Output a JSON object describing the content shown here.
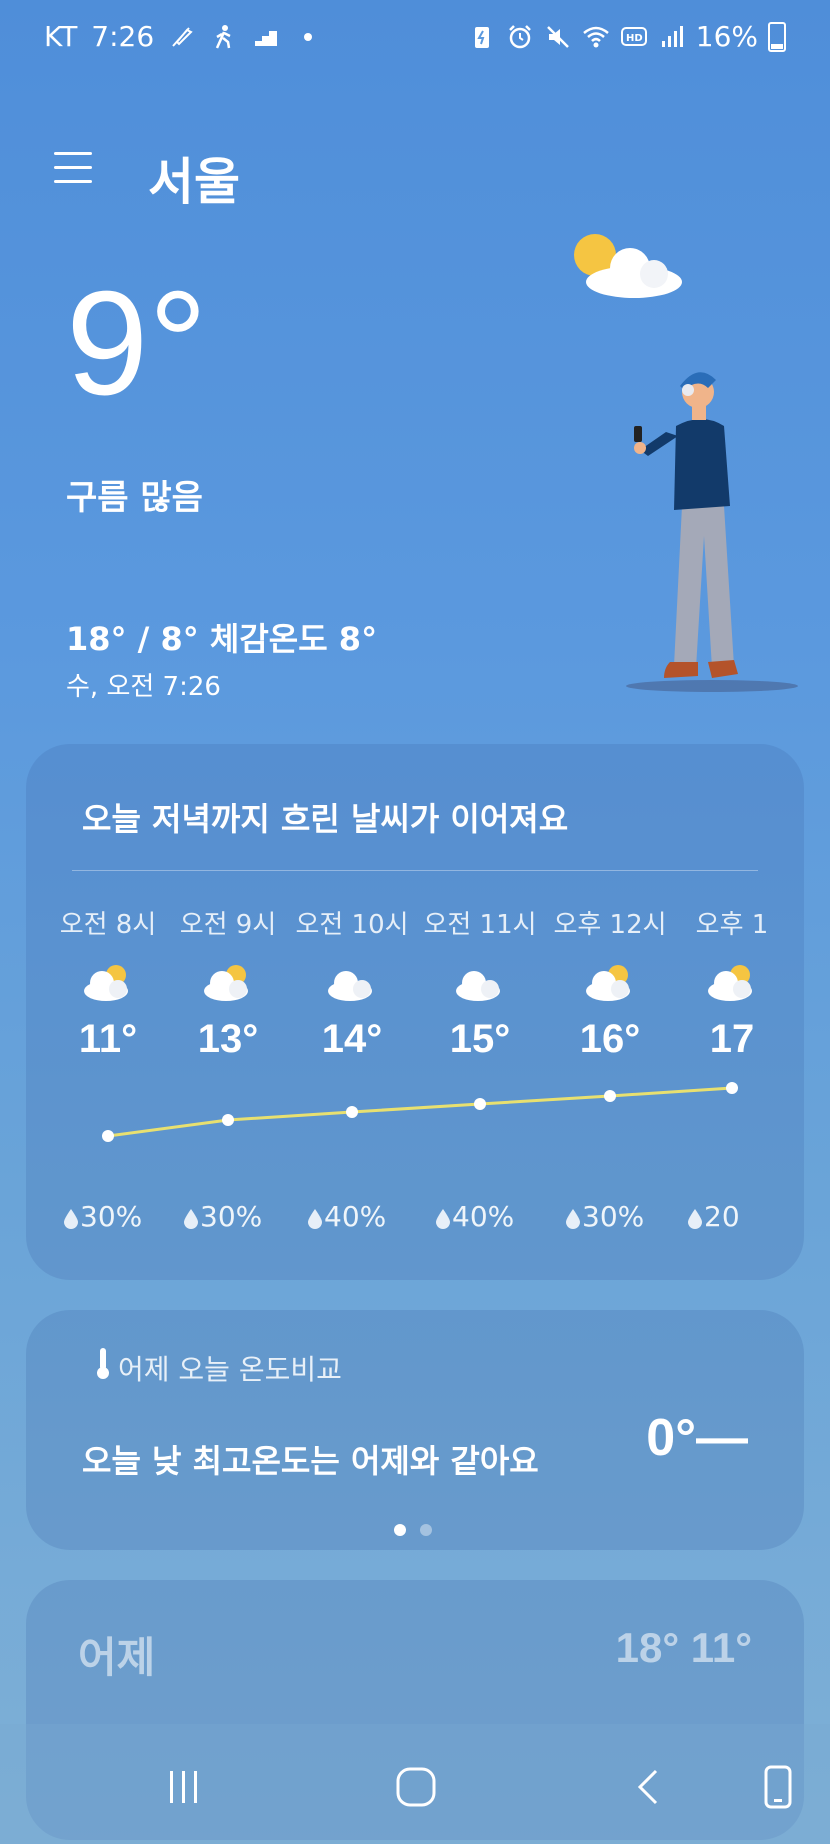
{
  "status": {
    "carrier": "KT",
    "time": "7:26",
    "battery": "16%"
  },
  "header": {
    "city": "서울"
  },
  "current": {
    "temp": "9°",
    "condition": "구름 많음",
    "range": "18° / 8° 체감온도 8°",
    "datetime": "수, 오전 7:26"
  },
  "forecast": {
    "headline": "오늘 저녁까지 흐린 날씨가 이어져요",
    "hours": [
      {
        "label": "오전 8시",
        "temp": "11°",
        "precip": "30%",
        "icon": "partly-sunny-icon"
      },
      {
        "label": "오전 9시",
        "temp": "13°",
        "precip": "30%",
        "icon": "partly-sunny-icon"
      },
      {
        "label": "오전 10시",
        "temp": "14°",
        "precip": "40%",
        "icon": "cloudy-icon"
      },
      {
        "label": "오전 11시",
        "temp": "15°",
        "precip": "40%",
        "icon": "cloudy-icon"
      },
      {
        "label": "오후 12시",
        "temp": "16°",
        "precip": "30%",
        "icon": "partly-sunny-icon"
      },
      {
        "label": "오후 1",
        "temp": "17",
        "precip": "20",
        "icon": "partly-sunny-icon"
      }
    ]
  },
  "comparison": {
    "title": "어제 오늘 온도비교",
    "text": "오늘 낮 최고온도는 어제와 같아요",
    "value": "0°—"
  },
  "yesterday": {
    "label": "어제",
    "temps": "18° 11°"
  },
  "colors": {
    "sun": "#f5c542",
    "line": "#e8e070"
  }
}
